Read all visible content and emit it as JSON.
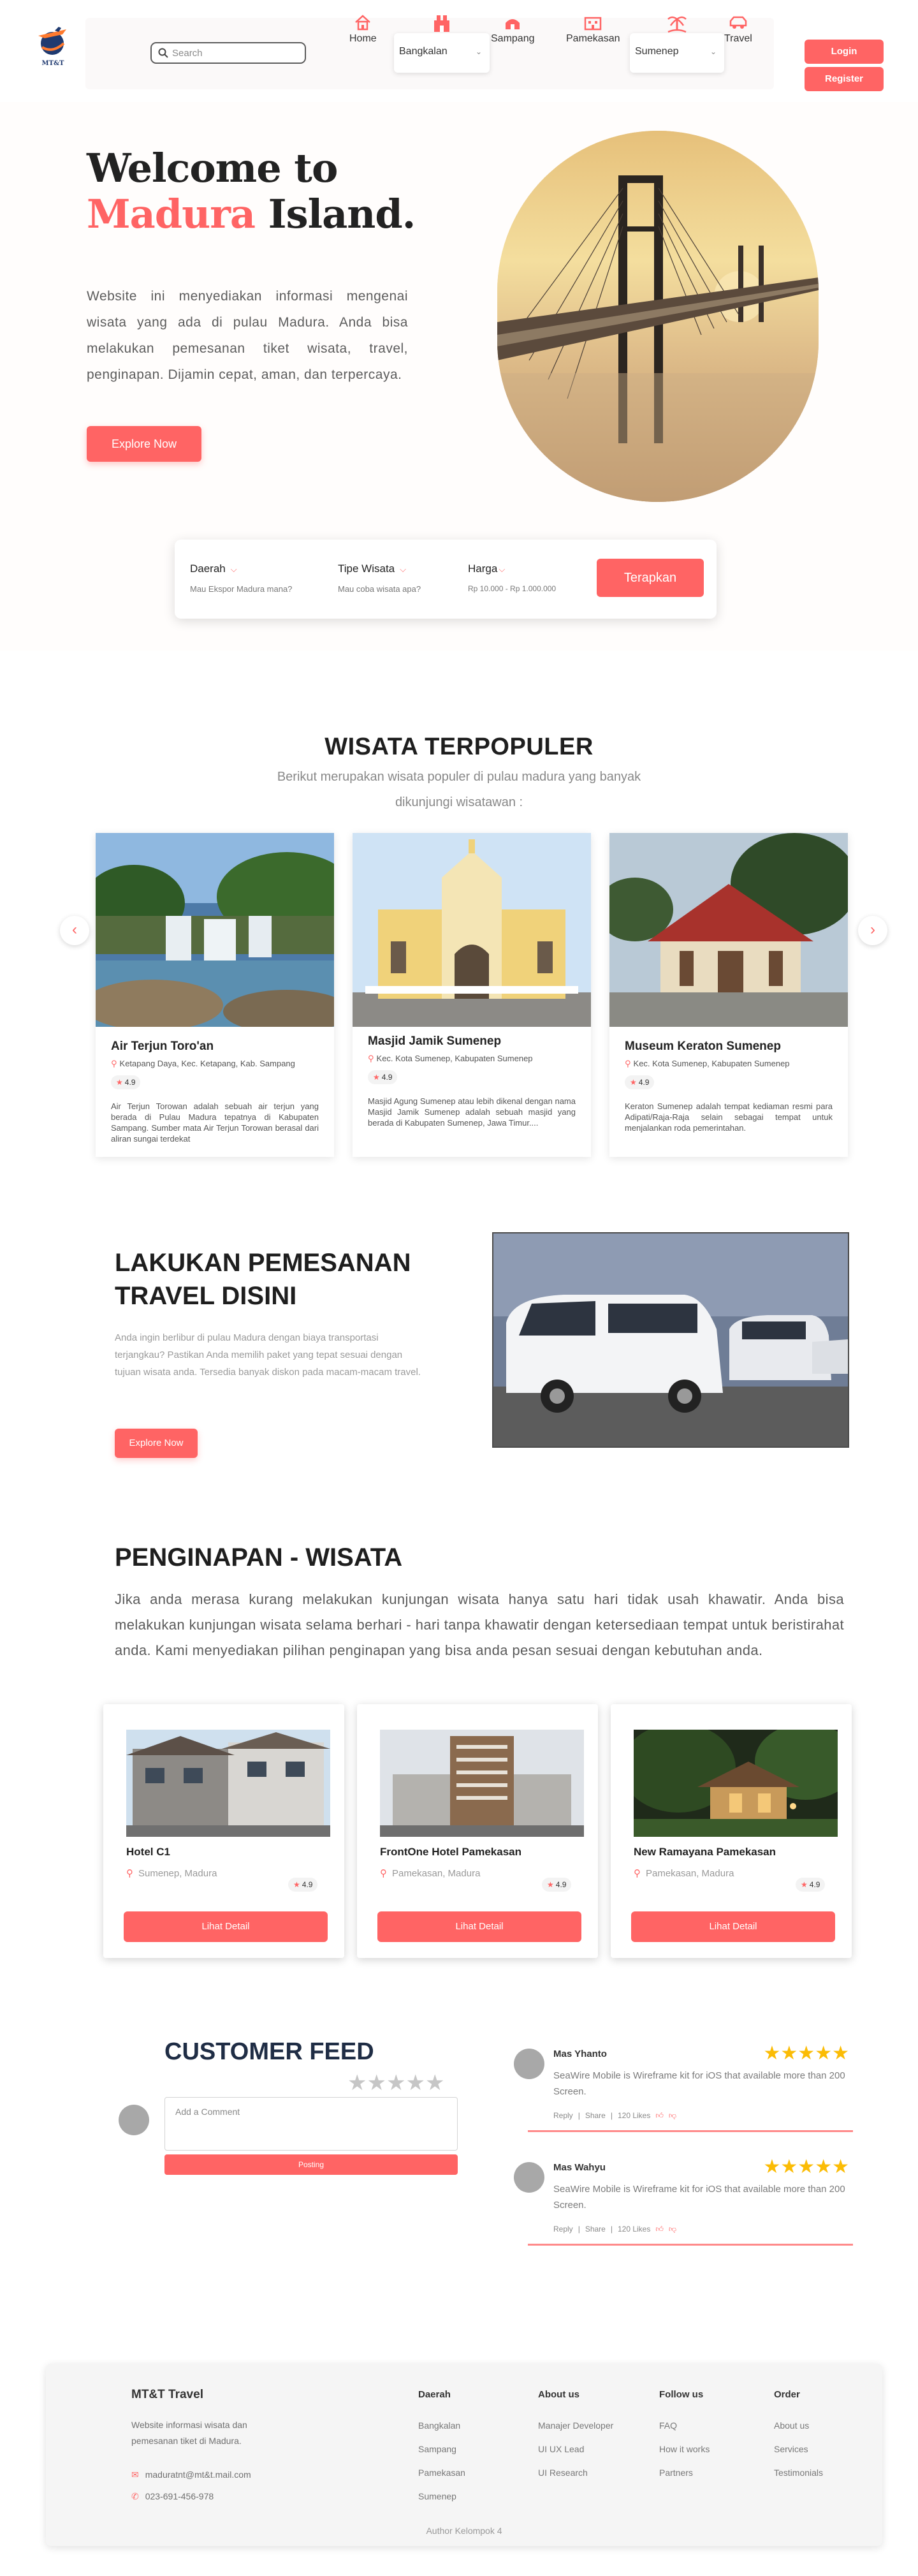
{
  "brand": {
    "logo_text": "MT&T"
  },
  "colors": {
    "accent": "#ff6464",
    "star": "#fbbc05",
    "navy": "#1f3a70"
  },
  "nav": {
    "search_placeholder": "Search",
    "home": "Home",
    "bangkalan": "Bangkalan",
    "sampang": "Sampang",
    "pamekasan": "Pamekasan",
    "sumenep": "Sumenep",
    "travel": "Travel",
    "login": "Login",
    "register": "Register"
  },
  "hero": {
    "title_line1": "Welcome to",
    "title_accent": "Madura",
    "title_rest": " Island.",
    "description": "Website ini menyediakan informasi mengenai wisata yang ada di pulau Madura. Anda bisa melakukan pemesanan tiket wisata, travel, penginapan. Dijamin cepat, aman, dan terpercaya.",
    "button": "Explore Now"
  },
  "filter": {
    "daerah_label": "Daerah",
    "daerah_hint": "Mau Ekspor Madura mana?",
    "tipe_label": "Tipe Wisata",
    "tipe_hint": "Mau coba wisata apa?",
    "harga_label": "Harga",
    "harga_hint": "Rp 10.000 - Rp 1.000.000",
    "button": "Terapkan"
  },
  "populer": {
    "title": "WISATA TERPOPULER",
    "subtitle": "Berikut merupakan wisata populer di pulau madura yang banyak dikunjungi wisatawan :",
    "cards": [
      {
        "name": "Air Terjun Toro'an",
        "location": "Ketapang Daya, Kec. Ketapang, Kab. Sampang",
        "rating": "4.9",
        "description": "Air Terjun Torowan adalah sebuah air terjun yang berada di Pulau Madura tepatnya di Kabupaten Sampang. Sumber mata Air Terjun Torowan berasal dari aliran sungai terdekat"
      },
      {
        "name": "Masjid Jamik Sumenep",
        "location": "Kec. Kota Sumenep, Kabupaten Sumenep",
        "rating": "4.9",
        "description": "Masjid Agung Sumenep atau lebih dikenal dengan nama Masjid Jamik Sumenep adalah sebuah masjid yang berada di Kabupaten Sumenep, Jawa Timur...."
      },
      {
        "name": "Museum Keraton Sumenep",
        "location": "Kec. Kota Sumenep, Kabupaten Sumenep",
        "rating": "4.9",
        "description": "Keraton Sumenep adalah tempat kediaman resmi para Adipati/Raja-Raja selain sebagai tempat untuk menjalankan roda pemerintahan."
      }
    ]
  },
  "travel": {
    "title_line1": "LAKUKAN PEMESANAN",
    "title_line2": "TRAVEL DISINI",
    "description": "Anda ingin berlibur di pulau Madura dengan biaya transportasi terjangkau? Pastikan Anda memilih paket yang tepat sesuai dengan tujuan wisata anda. Tersedia banyak diskon pada macam-macam travel.",
    "button": "Explore Now"
  },
  "penginapan": {
    "title": "PENGINAPAN - WISATA",
    "description": "Jika anda merasa kurang melakukan kunjungan wisata hanya satu hari tidak usah khawatir. Anda bisa melakukan kunjungan wisata selama berhari - hari tanpa khawatir dengan ketersediaan tempat untuk beristirahat anda. Kami menyediakan pilihan penginapan yang bisa anda pesan sesuai dengan kebutuhan anda.",
    "hotels": [
      {
        "name": "Hotel C1",
        "location": "Sumenep, Madura",
        "rating": "4.9",
        "button": "Lihat Detail"
      },
      {
        "name": "FrontOne Hotel Pamekasan",
        "location": "Pamekasan, Madura",
        "rating": "4.9",
        "button": "Lihat Detail"
      },
      {
        "name": "New Ramayana Pamekasan",
        "location": "Pamekasan, Madura",
        "rating": "4.9",
        "button": "Lihat Detail"
      }
    ]
  },
  "feed": {
    "title": "CUSTOMER FEED",
    "comment_placeholder": "Add a Comment",
    "post_button": "Posting",
    "user_stars": 0,
    "reviews": [
      {
        "name": "Mas Yhanto",
        "stars": 5,
        "text": "SeaWire Mobile is Wireframe kit for iOS that available more than 200 Screen.",
        "reply": "Reply",
        "share": "Share",
        "likes": "120 Likes"
      },
      {
        "name": "Mas Wahyu",
        "stars": 5,
        "text": "SeaWire Mobile is Wireframe kit for iOS that available more than 200 Screen.",
        "reply": "Reply",
        "share": "Share",
        "likes": "120 Likes"
      }
    ]
  },
  "footer": {
    "brand": "MT&T Travel",
    "description": "Website informasi wisata dan pemesanan tiket di Madura.",
    "email": "maduratnt@mt&t.mail.com",
    "phone": "023-691-456-978",
    "cols": [
      {
        "heading": "Daerah",
        "links": [
          "Bangkalan",
          "Sampang",
          "Pamekasan",
          "Sumenep"
        ]
      },
      {
        "heading": "About us",
        "links": [
          "Manajer Developer",
          "UI UX Lead",
          "UI Research"
        ]
      },
      {
        "heading": "Follow us",
        "links": [
          "FAQ",
          "How it works",
          "Partners"
        ]
      },
      {
        "heading": "Order",
        "links": [
          "About us",
          "Services",
          "Testimonials"
        ]
      }
    ],
    "author": "Author Kelompok 4"
  }
}
